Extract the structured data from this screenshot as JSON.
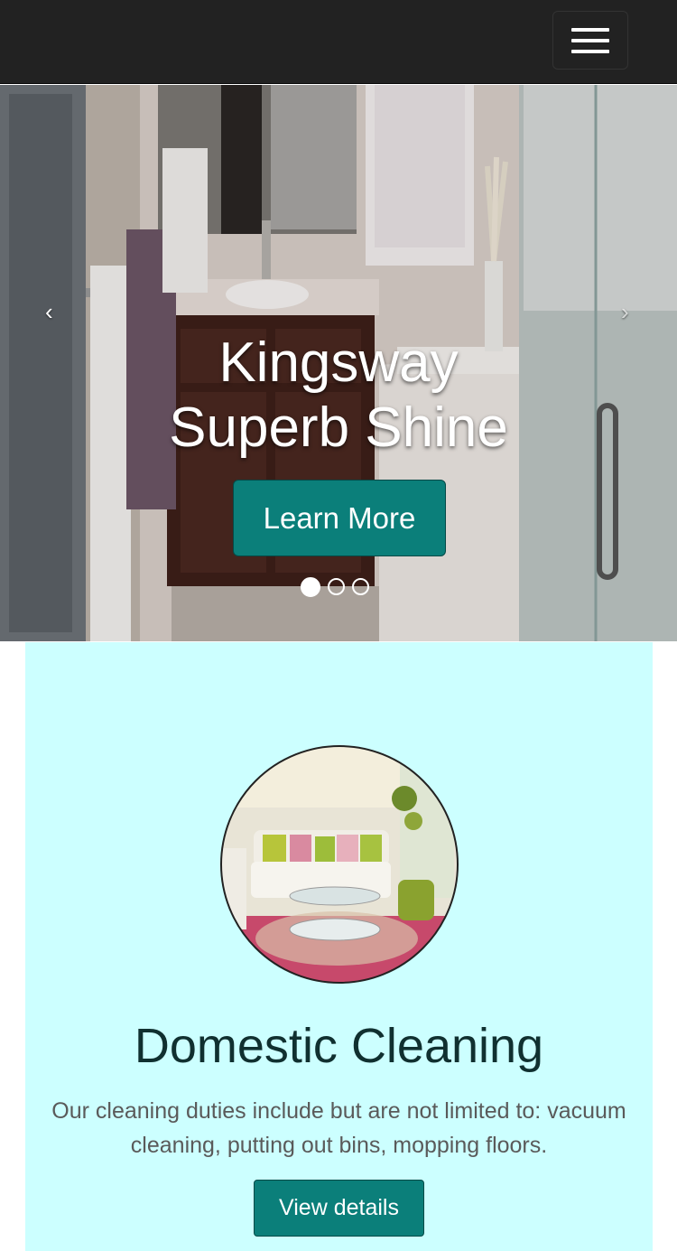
{
  "navbar": {
    "toggle_icon": "hamburger-menu-icon"
  },
  "carousel": {
    "title": "Kingsway Superb Shine",
    "button_label": "Learn More",
    "prev_label": "‹",
    "next_label": "›",
    "slides_count": 3,
    "active_slide": 1
  },
  "service": {
    "title": "Domestic Cleaning",
    "description": "Our cleaning duties include but are not limited to: vacuum cleaning, putting out bins, mopping floors.",
    "button_label": "View details",
    "image": "living-room-photo"
  },
  "colors": {
    "navbar_bg": "#222222",
    "accent": "#0b7f7a",
    "service_bg": "#ccffff"
  }
}
